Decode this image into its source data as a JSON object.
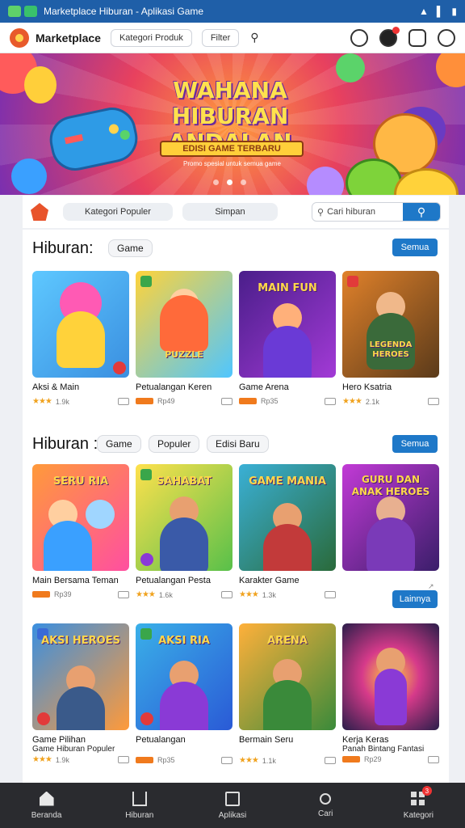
{
  "status_bar": {
    "text": "Marketplace Hiburan - Aplikasi Game",
    "icons": [
      "app-icon",
      "whatsapp-icon",
      "wifi-icon",
      "signal-icon",
      "battery-icon"
    ]
  },
  "top_bar": {
    "brand": "Marketplace",
    "category_button": "Kategori Produk",
    "filter_button": "Filter",
    "icons": [
      "logo-icon",
      "search-icon",
      "notification-icon",
      "cart-icon",
      "settings-icon",
      "profile-icon"
    ]
  },
  "banner": {
    "title": "WAHANA HIBURAN ANDALAN",
    "strip": "EDISI GAME TERBARU",
    "caption": "Promo spesial untuk semua game",
    "slide_count": 3,
    "active_slide": 1
  },
  "filter_bar": {
    "category_pill": "Kategori Populer",
    "sort_pill": "Simpan",
    "search_placeholder": "Cari hiburan"
  },
  "sections": [
    {
      "title": "Hiburan:",
      "chips": [
        "Game"
      ],
      "button": "Semua",
      "cards": [
        {
          "title": "Aksi & Main",
          "sub": "",
          "rating_stars": 3,
          "meta": "1.9k",
          "thumb_text": "",
          "tag": false
        },
        {
          "title": "Petualangan Keren",
          "sub": "",
          "rating_stars": 0,
          "meta": "Rp49",
          "thumb_text": "PUZZLE",
          "tag": true
        },
        {
          "title": "Game Arena",
          "sub": "",
          "rating_stars": 0,
          "meta": "Rp35",
          "thumb_text": "MAIN FUN",
          "tag": true
        },
        {
          "title": "Hero Ksatria",
          "sub": "",
          "rating_stars": 3,
          "meta": "2.1k",
          "thumb_text": "LEGENDA HEROES",
          "tag": false
        }
      ]
    },
    {
      "title": "Hiburan :",
      "chips": [
        "Game",
        "Populer",
        "Edisi Baru"
      ],
      "button": "Semua",
      "cards": [
        {
          "title": "Main Bersama Teman",
          "sub": "",
          "rating_stars": 0,
          "meta": "Rp39",
          "thumb_text": "SERU RIA",
          "tag": true
        },
        {
          "title": "Petualangan Pesta",
          "sub": "",
          "rating_stars": 3,
          "meta": "1.6k",
          "thumb_text": "SAHABAT",
          "tag": false
        },
        {
          "title": "Karakter Game",
          "sub": "",
          "rating_stars": 3,
          "meta": "1.3k",
          "thumb_text": "GAME MANIA",
          "tag": false
        },
        {
          "title": "",
          "sub": "",
          "rating_stars": 0,
          "meta": "",
          "thumb_text": "GURU DAN ANAK HEROES",
          "tag": false
        }
      ],
      "extra_button": "Lainnya"
    },
    {
      "title": "",
      "chips": [],
      "button": "",
      "cards": [
        {
          "title": "Game Pilihan",
          "sub": "Game Hiburan Populer",
          "rating_stars": 3,
          "meta": "1.9k",
          "thumb_text": "AKSI HEROES",
          "tag": false
        },
        {
          "title": "Petualangan",
          "sub": "",
          "rating_stars": 0,
          "meta": "Rp35",
          "thumb_text": "AKSI RIA",
          "tag": true
        },
        {
          "title": "Bermain Seru",
          "sub": "",
          "rating_stars": 3,
          "meta": "1.1k",
          "thumb_text": "ARENA",
          "tag": false
        },
        {
          "title": "Kerja Keras",
          "sub": "Panah Bintang Fantasi",
          "rating_stars": 0,
          "meta": "Rp29",
          "thumb_text": "",
          "tag": true
        }
      ]
    }
  ],
  "bottom_nav": {
    "items": [
      {
        "label": "Beranda",
        "icon": "home-icon"
      },
      {
        "label": "Hiburan",
        "icon": "house-icon"
      },
      {
        "label": "Aplikasi",
        "icon": "box-icon"
      },
      {
        "label": "Cari",
        "icon": "search-icon"
      },
      {
        "label": "Kategori",
        "icon": "grid-icon"
      }
    ],
    "badge": "3"
  },
  "colors": {
    "status_bar": "#1f5fa8",
    "accent_blue": "#1e78c8",
    "accent_orange": "#f07a1d",
    "nav_bg": "#2a2b2f"
  }
}
